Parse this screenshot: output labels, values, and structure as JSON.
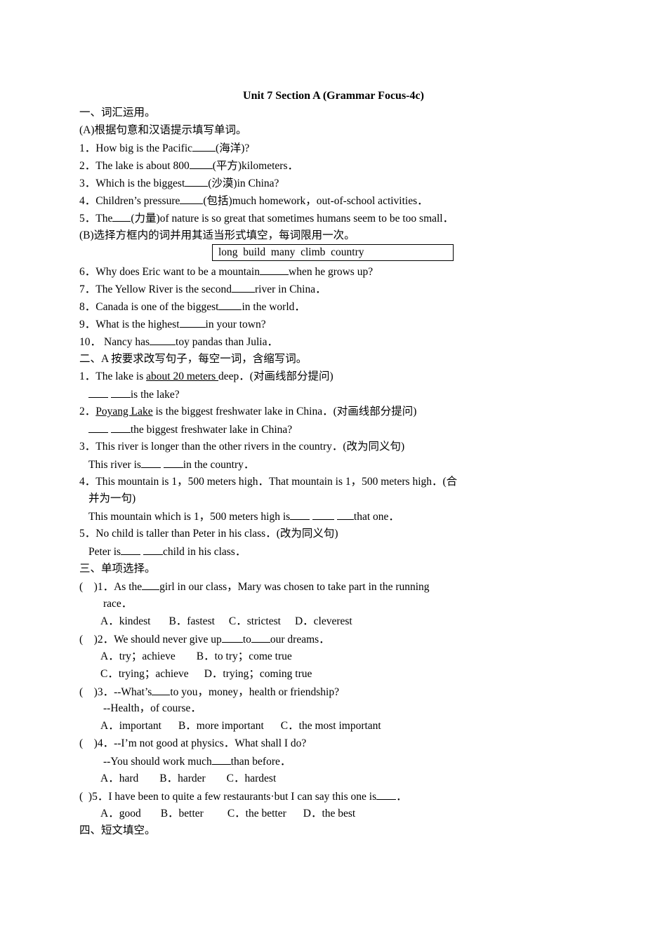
{
  "title": "Unit 7 Section A  (Grammar Focus-4c)",
  "part1": {
    "heading": "一、词汇运用。",
    "sectionA": {
      "instruction": "(A)根据句意和汉语提示填写单词。",
      "items": [
        {
          "num": "1．",
          "before": "How big is the Pacific",
          "after": "(海洋)?"
        },
        {
          "num": "2．",
          "before": "The lake is about 800",
          "after": "(平方)kilometers．"
        },
        {
          "num": "3．",
          "before": "Which is the biggest",
          "after": "(沙漠)in China?"
        },
        {
          "num": "4．",
          "before": "Children’s pressure",
          "after": "(包括)much homework，out-of-school activities．"
        },
        {
          "num": "5．",
          "before": "The",
          "after": "(力量)of nature is so great that sometimes humans seem to be too small．"
        }
      ]
    },
    "sectionB": {
      "instruction": "(B)选择方框内的词并用其适当形式填空，每词限用一次。",
      "word_box": "long  build  many  climb  country",
      "items": [
        {
          "num": "6．",
          "before": "Why does Eric want to be a mountain",
          "after": "when he grows up?"
        },
        {
          "num": "7．",
          "before": "The Yellow River is the second",
          "after": "river in China．"
        },
        {
          "num": "8．",
          "before": "Canada is one of the biggest",
          "after": "in the world．"
        },
        {
          "num": "9．",
          "before": "What is the highest",
          "after": "in your town?"
        },
        {
          "num": "10．",
          "before": "Nancy has",
          "after": "toy pandas than Julia．"
        }
      ]
    }
  },
  "part2": {
    "heading": "二、A 按要求改写句子，每空一词，含缩写词。",
    "items": [
      {
        "num": "1．",
        "pre": "The lake is ",
        "underlined": "about 20 meters ",
        "post": "deep．(对画线部分提问)",
        "answer_after": "is the lake?"
      },
      {
        "num": "2．",
        "pre": "",
        "underlined": "Poyang Lake",
        "post": " is the biggest freshwater lake in China．(对画线部分提问)",
        "answer_after": "the biggest freshwater lake in China?"
      },
      {
        "num": "3．",
        "text": "This river is longer than the other rivers in the country．(改为同义句)",
        "answer_before": "This river is",
        "answer_after": "in the country．"
      },
      {
        "num": "4．",
        "text": "This mountain is 1，500 meters high．That mountain is 1，500 meters high．(合",
        "text_cont": "并为一句)",
        "answer_before": "This mountain which is 1，500 meters high is",
        "answer_after": "that one．"
      },
      {
        "num": "5．",
        "text": "No child is taller than Peter in his class．(改为同义句)",
        "answer_before": "Peter is",
        "answer_after": "child in his class．"
      }
    ]
  },
  "part3": {
    "heading": "三、单项选择。",
    "questions": [
      {
        "paren": "(    )",
        "num": "1．",
        "before": "As the",
        "after": "girl in our class，Mary was chosen to take part in the running",
        "cont": "race．",
        "options": [
          "A．kindest",
          "B．fastest",
          "C．strictest",
          "D．cleverest"
        ]
      },
      {
        "paren": "(    )",
        "num": "2．",
        "before": "We should never give up",
        "mid": "to",
        "after": "our dreams．",
        "options": [
          "A．try；achieve",
          "B．to try；come true",
          "C．trying；achieve",
          "D．trying；coming true"
        ]
      },
      {
        "paren": "(    )",
        "num": "3．",
        "before": "--What’s",
        "after": "to you，money，health or friendship?",
        "cont": "--Health，of course．",
        "options": [
          "A．important",
          "B．more important",
          "C．the most important"
        ]
      },
      {
        "paren": "(    )",
        "num": "4．",
        "text": "--I’m not good at physics．What shall I do?",
        "cont_before": "--You should work much",
        "cont_after": "than before．",
        "options": [
          "A．hard",
          "B．harder",
          "C．hardest"
        ]
      },
      {
        "paren": "(  )",
        "num": "5．",
        "before": "I have been to quite a few restaurants·but I can say this one is",
        "after": "．",
        "options": [
          "A．good",
          "B．better",
          "C．the better",
          "D．the best"
        ]
      }
    ]
  },
  "part4": {
    "heading": "四、短文填空。"
  }
}
